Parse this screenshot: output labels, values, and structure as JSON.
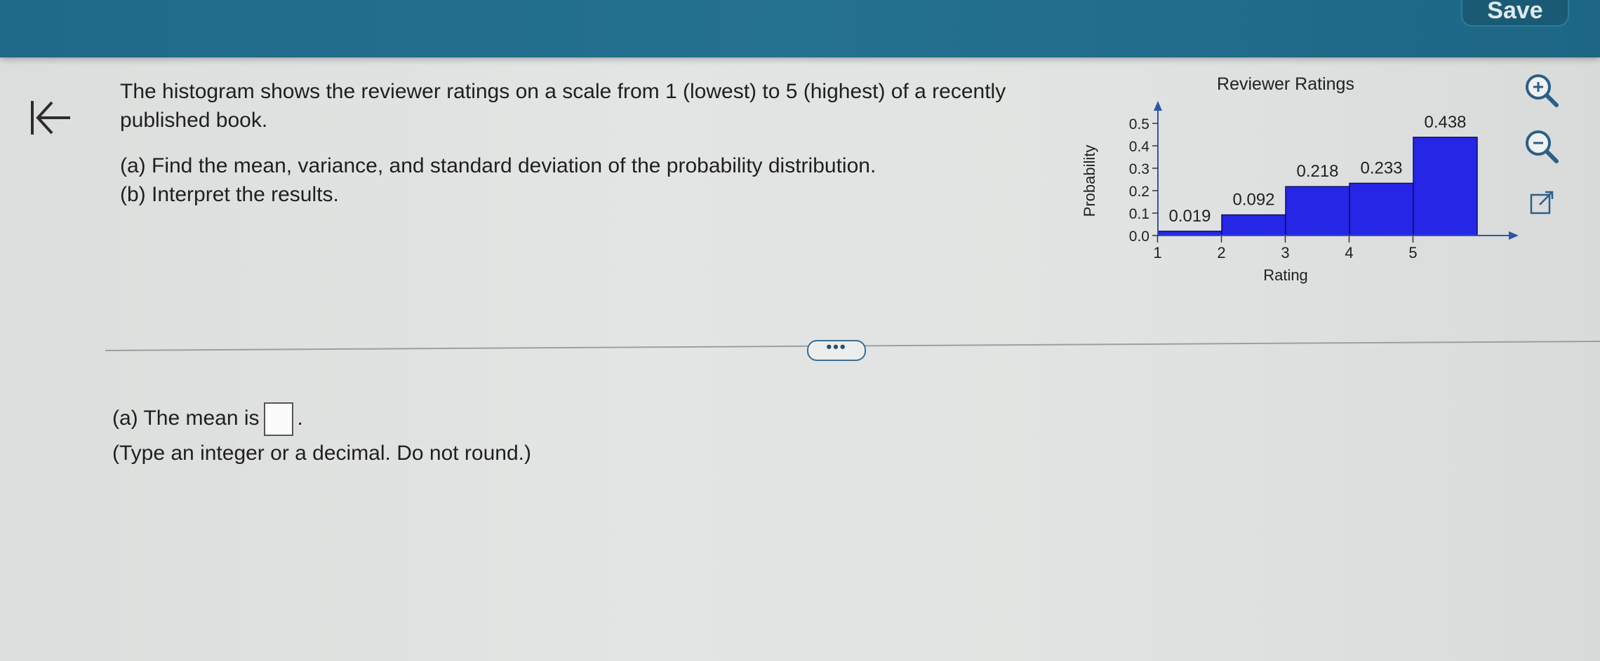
{
  "header": {
    "save_label": "Save"
  },
  "question": {
    "intro": "The histogram shows the reviewer ratings on a scale from 1 (lowest) to 5 (highest) of a recently published book.",
    "part_a": "(a) Find the mean, variance, and standard deviation of the probability distribution.",
    "part_b": "(b) Interpret the results."
  },
  "answer": {
    "prefix": "(a) The mean is",
    "suffix": ".",
    "hint": "(Type an integer or a decimal. Do not round.)",
    "value": ""
  },
  "more_label": "•••",
  "icons": [
    "back-arrow-icon",
    "zoom-in-icon",
    "zoom-out-icon",
    "external-link-icon"
  ],
  "colors": {
    "header": "#24718f",
    "bar": "#2626e6",
    "text": "#1f1f1f"
  },
  "chart_data": {
    "type": "bar",
    "title": "Reviewer Ratings",
    "xlabel": "Rating",
    "ylabel": "Probability",
    "categories": [
      "1",
      "2",
      "3",
      "4",
      "5"
    ],
    "values": [
      0.019,
      0.092,
      0.218,
      0.233,
      0.438
    ],
    "data_labels": [
      "0.019",
      "0.092",
      "0.218",
      "0.233",
      "0.438"
    ],
    "y_ticks": [
      "0.0",
      "0.1",
      "0.2",
      "0.3",
      "0.4",
      "0.5"
    ],
    "ylim": [
      0,
      0.5
    ],
    "grid": false,
    "legend": false
  }
}
